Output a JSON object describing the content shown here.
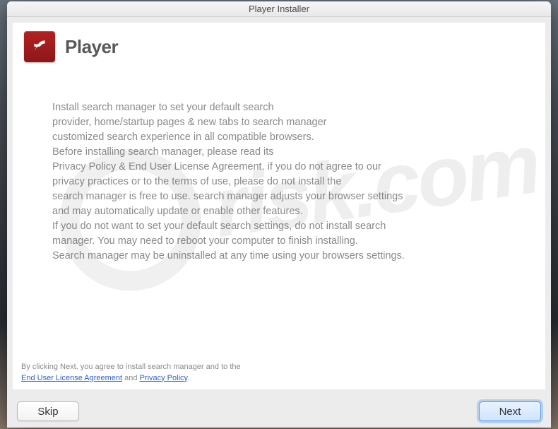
{
  "window": {
    "title": "Player Installer"
  },
  "header": {
    "app_name": "Player",
    "logo_name": "flash-icon"
  },
  "body": {
    "lines": [
      "Install search manager to set your default search",
      "provider, home/startup pages & new tabs to search manager",
      "customized search experience in all compatible browsers.",
      "Before installing search manager, please read its",
      "Privacy Policy & End User License Agreement. if you do not agree to our",
      "privacy practices or to the terms of use, please do not install the",
      "search manager is free to use. search manager adjusts your browser settings",
      "and may automatically update or enable other features.",
      "If you do not want to set your default search settings, do not install search",
      "manager. You may need to reboot your computer to finish installing.",
      "Search manager may be uninstalled at any time using your browsers settings."
    ]
  },
  "footer": {
    "prefix": "By clicking Next, you agree to install search manager and to the",
    "eula_label": "End User License Agreement",
    "and": " and ",
    "privacy_label": "Privacy Policy",
    "suffix": "."
  },
  "buttons": {
    "skip": "Skip",
    "next": "Next"
  },
  "watermark": {
    "text": "risk.com"
  }
}
